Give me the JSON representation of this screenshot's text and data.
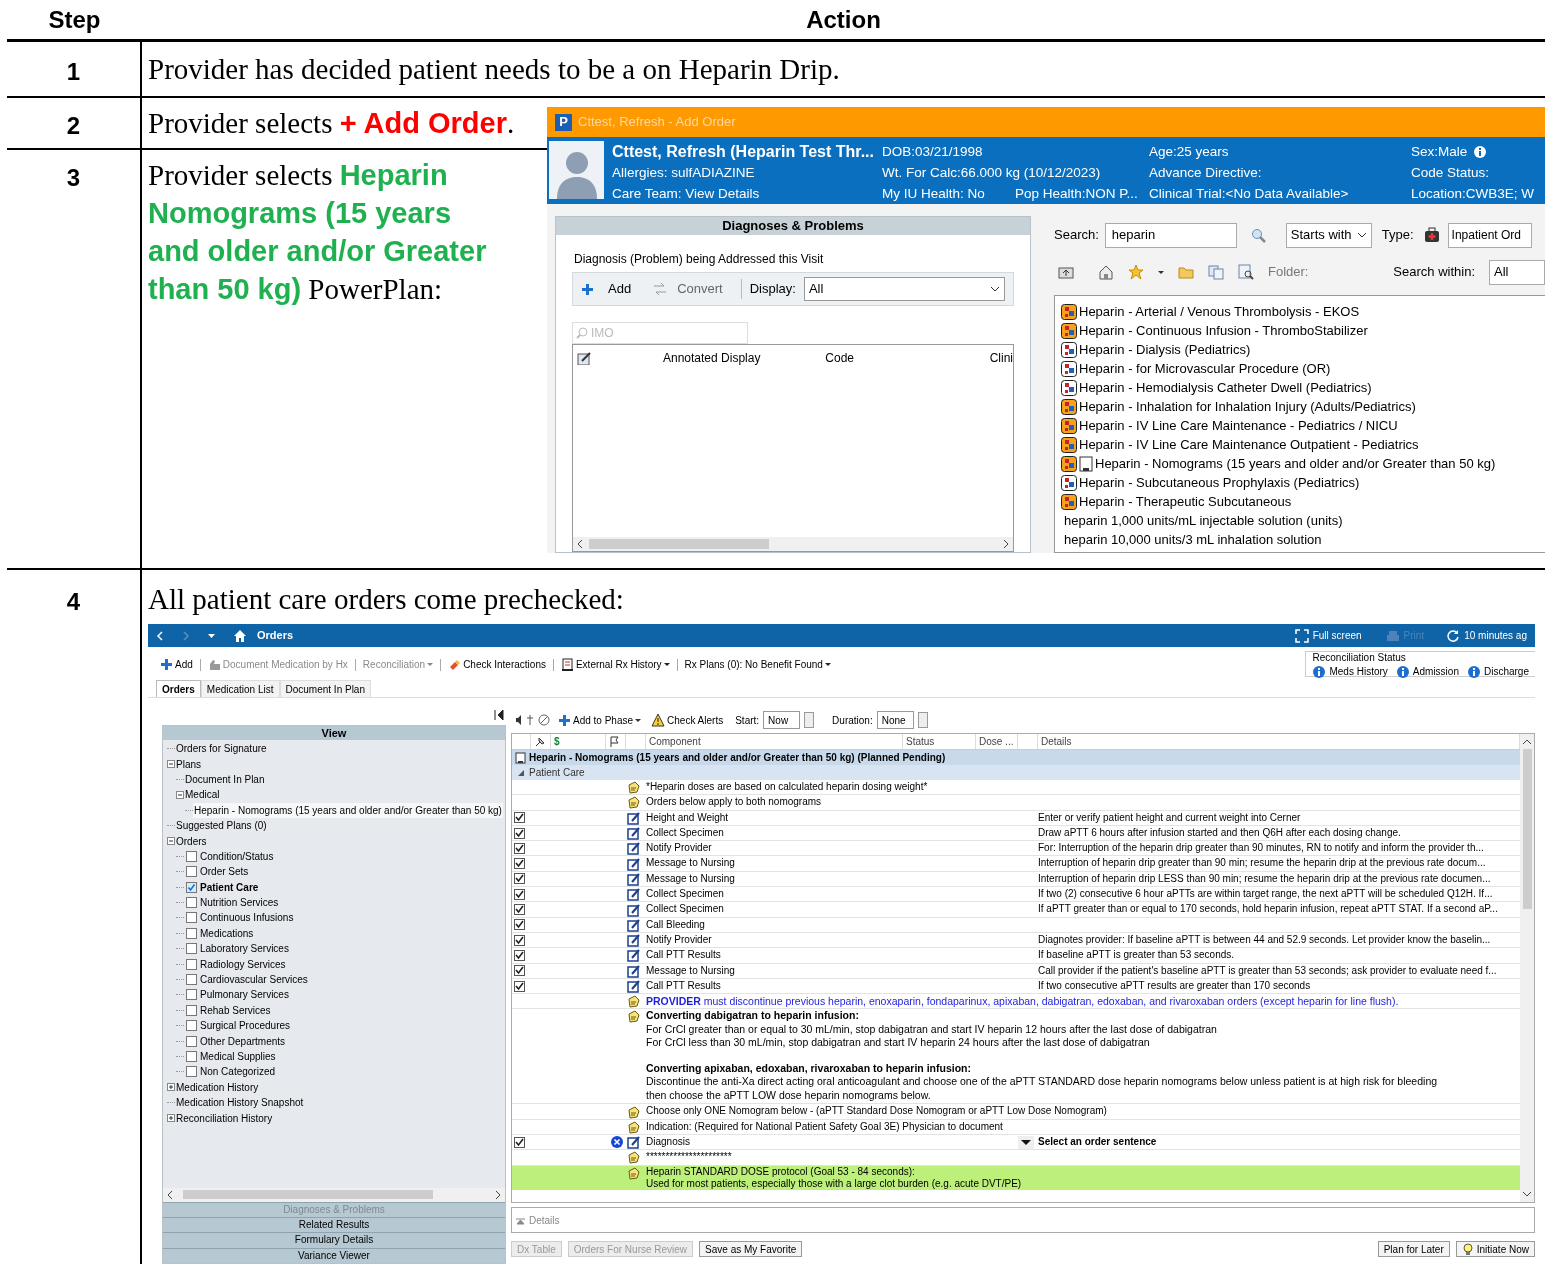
{
  "table": {
    "columns": [
      "Step",
      "Action"
    ],
    "rows": [
      {
        "step": "1",
        "action": [
          {
            "text": "Provider has decided patient needs to be a on Heparin Drip.",
            "kind": "plain"
          }
        ]
      },
      {
        "step": "2",
        "action": [
          {
            "text": "Provider selects ",
            "kind": "plain"
          },
          {
            "text": "+ Add Order",
            "kind": "command"
          },
          {
            "text": ".",
            "kind": "plain"
          }
        ]
      },
      {
        "step": "3",
        "action": [
          {
            "text": "Provider selects ",
            "kind": "plain"
          },
          {
            "text": "Heparin Nomograms (15 years and older and/or Greater than 50 kg)",
            "kind": "plan"
          },
          {
            "text": " PowerPlan:",
            "kind": "plain"
          }
        ]
      },
      {
        "step": "4",
        "action": [
          {
            "text": "All patient care orders come prechecked:",
            "kind": "plain"
          }
        ]
      }
    ]
  },
  "add_order_window": {
    "logo_text": "P",
    "title": "Cttest, Refresh - Add Order",
    "banner": [
      [
        "Cttest, Refresh (Heparin Test Thr...",
        "DOB:03/21/1998",
        "Age:25 years",
        "Sex:Male"
      ],
      [
        "Allergies: sulfADIAZINE",
        "Wt. For Calc:66.000 kg (10/12/2023)",
        "Advance Directive:",
        "Code Status:"
      ],
      [
        "Care Team: View Details",
        "My IU Health: No",
        "Pop Health:NON P...",
        "Clinical Trial:<No Data Available>",
        "Location:CWB3E; W"
      ]
    ],
    "diagnoses": {
      "header": "Diagnoses & Problems",
      "group_label": "Diagnosis (Problem) being Addressed this Visit",
      "add": "Add",
      "convert": "Convert",
      "display_label": "Display:",
      "display_value": "All",
      "search_placeholder": "IMO",
      "columns": [
        "Annotated Display",
        "Code",
        "Clini"
      ]
    },
    "search": {
      "label": "Search:",
      "value": "heparin",
      "mode": "Starts with",
      "type_label": "Type:",
      "type_value": "Inpatient Ord",
      "folder_label": "Folder:",
      "within_label": "Search within:",
      "within_value": "All"
    },
    "results": [
      {
        "kind": "plan",
        "text": "Heparin - Arterial / Venous Thrombolysis - EKOS"
      },
      {
        "kind": "plan",
        "text": "Heparin - Continuous Infusion - ThromboStabilizer"
      },
      {
        "kind": "pedsplan",
        "text": "Heparin - Dialysis (Pediatrics)"
      },
      {
        "kind": "pedsplan",
        "text": "Heparin - for Microvascular Procedure (OR)"
      },
      {
        "kind": "pedsplan",
        "text": "Heparin - Hemodialysis Catheter Dwell (Pediatrics)"
      },
      {
        "kind": "plan",
        "text": "Heparin - Inhalation for Inhalation Injury (Adults/Pediatrics)"
      },
      {
        "kind": "plan",
        "text": "Heparin - IV Line Care Maintenance - Pediatrics / NICU"
      },
      {
        "kind": "plan",
        "text": "Heparin - IV Line Care Maintenance Outpatient - Pediatrics"
      },
      {
        "kind": "docplan",
        "text": "Heparin - Nomograms (15 years and older and/or Greater than 50 kg)"
      },
      {
        "kind": "pedsplan",
        "text": "Heparin - Subcutaneous Prophylaxis (Pediatrics)"
      },
      {
        "kind": "plan",
        "text": "Heparin - Therapeutic Subcutaneous"
      },
      {
        "kind": "order",
        "text": "heparin 1,000 units/mL injectable solution (units)"
      },
      {
        "kind": "order",
        "text": "heparin 10,000 units/3 mL inhalation solution"
      }
    ]
  },
  "orders_window": {
    "title": "Orders",
    "full_screen": "Full screen",
    "print": "Print",
    "refresh": "10 minutes ag",
    "toolbar": [
      {
        "kind": "add",
        "label": "Add",
        "disabled": false,
        "dropdown": false
      },
      {
        "kind": "document",
        "label": "Document Medication by Hx",
        "disabled": true,
        "dropdown": false
      },
      {
        "kind": "reconcile",
        "label": "Reconciliation",
        "disabled": true,
        "dropdown": true
      },
      {
        "kind": "interactions",
        "label": "Check Interactions",
        "disabled": false,
        "dropdown": false
      },
      {
        "kind": "external",
        "label": "External Rx History",
        "disabled": false,
        "dropdown": true
      },
      {
        "kind": "plans",
        "label": "Rx Plans (0): No Benefit Found",
        "disabled": false,
        "dropdown": true
      }
    ],
    "reconciliation": {
      "label": "Reconciliation Status",
      "items": [
        "Meds History",
        "Admission",
        "Discharge"
      ]
    },
    "tabs": [
      {
        "label": "Orders",
        "selected": true
      },
      {
        "label": "Medication List",
        "selected": false
      },
      {
        "label": "Document In Plan",
        "selected": false
      }
    ],
    "view_header": "View",
    "tree": [
      {
        "label": "Orders for Signature",
        "selected": false
      },
      {
        "label": "Plans",
        "selected": false,
        "expanded": true,
        "children": [
          {
            "label": "Document In Plan",
            "selected": false
          },
          {
            "label": "Medical",
            "selected": false,
            "expanded": true,
            "children": [
              {
                "label": "Heparin - Nomograms (15 years and older and/or Greater than 50 kg)",
                "selected": true
              }
            ]
          }
        ]
      },
      {
        "label": "Suggested Plans (0)",
        "selected": false
      },
      {
        "label": "Orders",
        "selected": false,
        "expanded": true,
        "children": [
          {
            "label": "Condition/Status",
            "selected": false,
            "checked": false
          },
          {
            "label": "Order Sets",
            "selected": false,
            "checked": false
          },
          {
            "label": "Patient Care",
            "selected": false,
            "checked": true
          },
          {
            "label": "Nutrition Services",
            "selected": false,
            "checked": false
          },
          {
            "label": "Continuous Infusions",
            "selected": false,
            "checked": false
          },
          {
            "label": "Medications",
            "selected": false,
            "checked": false
          },
          {
            "label": "Laboratory Services",
            "selected": false,
            "checked": false
          },
          {
            "label": "Radiology Services",
            "selected": false,
            "checked": false
          },
          {
            "label": "Cardiovascular Services",
            "selected": false,
            "checked": false
          },
          {
            "label": "Pulmonary Services",
            "selected": false,
            "checked": false
          },
          {
            "label": "Rehab Services",
            "selected": false,
            "checked": false
          },
          {
            "label": "Surgical Procedures",
            "selected": false,
            "checked": false
          },
          {
            "label": "Other Departments",
            "selected": false,
            "checked": false
          },
          {
            "label": "Medical Supplies",
            "selected": false,
            "checked": false
          },
          {
            "label": "Non Categorized",
            "selected": false,
            "checked": false
          }
        ]
      },
      {
        "label": "Medication History",
        "selected": false,
        "expanded": false
      },
      {
        "label": "Medication History Snapshot",
        "selected": false
      },
      {
        "label": "Reconciliation History",
        "selected": false,
        "expanded": false
      }
    ],
    "sections": [
      {
        "label": "Diagnoses & Problems",
        "disabled": true
      },
      {
        "label": "Related Results",
        "disabled": false
      },
      {
        "label": "Formulary Details",
        "disabled": false
      },
      {
        "label": "Variance Viewer",
        "disabled": false
      }
    ],
    "plan_toolbar": {
      "add_to_phase": "Add to Phase",
      "check_alerts": "Check Alerts",
      "start_label": "Start:",
      "start_value": "Now",
      "duration_label": "Duration:",
      "duration_value": "None"
    },
    "columns": [
      "$",
      "Component",
      "Status",
      "Dose ...",
      "Details"
    ],
    "plan_title": "Heparin - Nomograms (15 years and older and/or Greater than 50 kg) (Planned Pending)",
    "section_title": "Patient Care",
    "rows": [
      {
        "kind": "note",
        "text": "*Heparin doses are based on calculated heparin dosing weight*"
      },
      {
        "kind": "note",
        "text": "Orders below apply to both nomograms"
      },
      {
        "kind": "order",
        "checked": true,
        "component": "Height and Weight",
        "details": "Enter or verify patient height and current weight into Cerner"
      },
      {
        "kind": "order",
        "checked": true,
        "component": "Collect Specimen",
        "details": "Draw aPTT 6 hours after infusion started and then Q6H after each dosing change."
      },
      {
        "kind": "order",
        "checked": true,
        "component": "Notify Provider",
        "details": "For: Interruption of the heparin drip greater than 90 minutes, RN to notify and inform the provider th..."
      },
      {
        "kind": "order",
        "checked": true,
        "component": "Message to Nursing",
        "details": "Interruption of heparin drip greater than 90 min; resume the heparin drip at the previous rate docum..."
      },
      {
        "kind": "order",
        "checked": true,
        "component": "Message to Nursing",
        "details": "Interruption of heparin drip LESS than 90 min; resume the heparin drip at the previous rate documen..."
      },
      {
        "kind": "order",
        "checked": true,
        "component": "Collect Specimen",
        "details": "If two (2) consecutive 6 hour aPTTs are within target range, the next aPTT will be scheduled Q12H.  If..."
      },
      {
        "kind": "order",
        "checked": true,
        "component": "Collect Specimen",
        "details": "If aPTT greater than or equal to 170 seconds, hold heparin infusion, repeat aPTT STAT. If a second aP..."
      },
      {
        "kind": "order",
        "checked": true,
        "component": "Call Bleeding"
      },
      {
        "kind": "order",
        "checked": true,
        "component": "Notify Provider",
        "details": "Diagnotes provider:  If baseline aPTT is between 44 and 52.9 seconds.  Let provider know the baselin..."
      },
      {
        "kind": "order",
        "checked": true,
        "component": "Call PTT Results",
        "details": "If baseline aPTT is greater than 53 seconds."
      },
      {
        "kind": "order",
        "checked": true,
        "component": "Message to Nursing",
        "details": "Call provider if the patient's baseline aPTT is greater than 53 seconds; ask provider to evaluate need f..."
      },
      {
        "kind": "order",
        "checked": true,
        "component": "Call PTT Results",
        "details": "If two consecutive aPTT results are greater than 170 seconds"
      },
      {
        "kind": "alert",
        "text": "**PROVIDER** must discontinue previous heparin, enoxaparin, fondaparinux, apixaban, dabigatran, edoxaban, and rivaroxaban orders (except heparin for line flush)."
      },
      {
        "kind": "block",
        "paragraphs": [
          {
            "title": "Converting dabigatran to heparin infusion:",
            "lines": [
              "For CrCl greater than or equal to 30 mL/min, stop dabigatran and start IV heparin 12 hours after the last dose of dabigatran",
              "For CrCl less than 30 mL/min, stop dabigatran and start IV heparin 24 hours after the last dose of dabigatran"
            ]
          },
          {
            "title": "Converting apixaban, edoxaban, rivaroxaban to heparin infusion:",
            "lines": [
              "Discontinue the anti-Xa direct acting oral anticoagulant and choose one of the aPTT STANDARD dose heparin nomograms below unless patient is at high risk for bleeding",
              "then choose the aPTT LOW dose heparin nomograms below."
            ]
          }
        ]
      },
      {
        "kind": "note",
        "text": "Choose only ONE Nomogram below - (aPTT Standard Dose Nomogram or aPTT Low Dose Nomogram)"
      },
      {
        "kind": "note",
        "text": "Indication: (Required for National Patient Safety Goal 3E) Physician to document"
      },
      {
        "kind": "diagnosis",
        "checked": true,
        "component": "Diagnosis",
        "details": "Select an order sentence"
      },
      {
        "kind": "note",
        "text": "**********************"
      },
      {
        "kind": "highlight",
        "lines": [
          "Heparin STANDARD DOSE protocol (Goal 53 - 84 seconds):",
          "Used for most patients, especially those with a large clot burden (e.g. acute DVT/PE)"
        ]
      }
    ],
    "details_label": "Details",
    "buttons": [
      {
        "label": "Dx Table",
        "disabled": true
      },
      {
        "label": "Orders For Nurse Review",
        "disabled": true
      },
      {
        "label": "Save as My Favorite",
        "disabled": false
      }
    ],
    "right_buttons": [
      {
        "kind": "plain",
        "label": "Plan for Later"
      },
      {
        "kind": "bulb",
        "label": "Initiate Now"
      }
    ]
  }
}
